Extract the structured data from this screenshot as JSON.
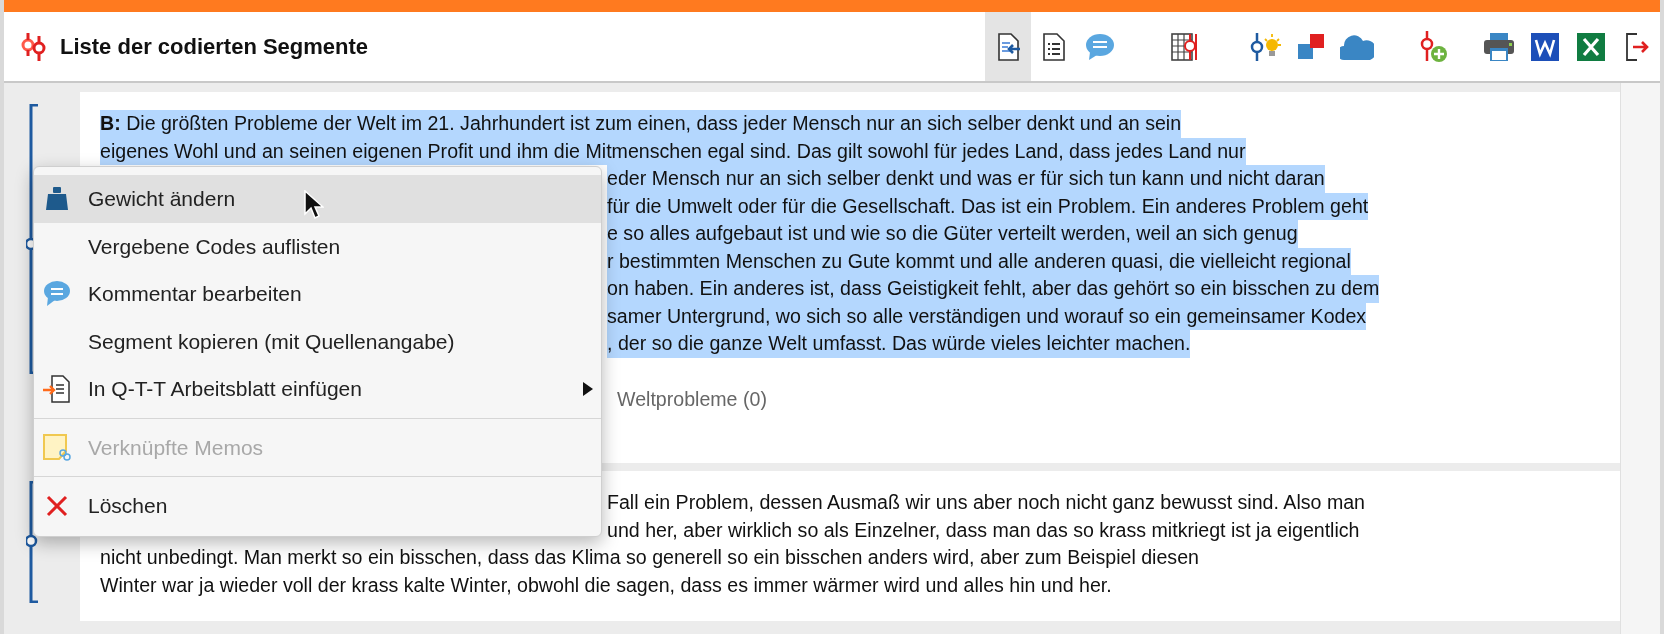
{
  "window": {
    "title": "Liste der codierten Segmente"
  },
  "toolbar": [
    {
      "selected": true
    },
    {
      "selected": false
    },
    {
      "selected": false
    },
    {
      "selected": false
    },
    {
      "selected": false
    },
    {
      "selected": false
    },
    {
      "selected": false
    },
    {
      "selected": false
    },
    {
      "selected": false
    },
    {
      "selected": false
    },
    {
      "selected": false
    },
    {
      "selected": false
    }
  ],
  "segments": [
    {
      "highlighted": true,
      "lines": [
        {
          "text": "**B:** Die größten Probleme der Welt im 21. Jahrhundert ist zum einen, dass jeder Mensch nur an sich selber denkt und an sein",
          "covered": false
        },
        {
          "text": "eigenes Wohl und an seinen eigenen Profit und ihm die Mitmenschen egal sind. Das gilt sowohl für jedes Land, dass jedes Land nur",
          "covered": false
        },
        {
          "text": "eder Mensch nur an sich selber denkt und was er für sich tun kann und nicht daran",
          "covered": true
        },
        {
          "text": "für die Umwelt oder für die Gesellschaft. Das ist ein Problem. Ein anderes Problem geht",
          "covered": true
        },
        {
          "text": "e so alles aufgebaut ist und wie so die Güter verteilt werden, weil an sich genug",
          "covered": true
        },
        {
          "text": "r bestimmten Menschen zu Gute kommt und alle anderen quasi, die vielleicht regional",
          "covered": true
        },
        {
          "text": "on haben. Ein anderes ist, dass Geistigkeit fehlt, aber das gehört so ein bisschen zu dem",
          "covered": true
        },
        {
          "text": "samer Untergrund, wo sich so alle verständigen und worauf so ein gemeinsamer Kodex",
          "covered": true
        },
        {
          "text": ", der so die ganze Welt umfasst. Das würde vieles leichter machen.",
          "covered": true
        }
      ],
      "code": "Weltprobleme (0)"
    },
    {
      "highlighted": false,
      "lines": [
        {
          "text": "Fall ein Problem, dessen Ausmaß wir uns aber noch nicht ganz bewusst sind. Also man",
          "covered": true
        },
        {
          "text": "und her, aber wirklich so als Einzelner, dass man das so krass mitkriegt ist ja eigentlich",
          "covered": true
        },
        {
          "text": "nicht unbedingt. Man merkt so ein bisschen, dass das Klima so generell so ein bisschen anders wird, aber zum Beispiel diesen",
          "covered": false
        },
        {
          "text": "Winter war ja wieder voll der krass kalte Winter, obwohl die sagen, dass es immer wärmer wird und alles hin und her.",
          "covered": false
        }
      ]
    }
  ],
  "context_menu": {
    "groups": [
      [
        {
          "label": "Gewicht ändern",
          "selected": true,
          "disabled": false,
          "submenu": false
        },
        {
          "label": "Vergebene Codes auflisten",
          "selected": false,
          "disabled": false,
          "submenu": false
        },
        {
          "label": "Kommentar bearbeiten",
          "selected": false,
          "disabled": false,
          "submenu": false
        },
        {
          "label": "Segment kopieren (mit Quellenangabe)",
          "selected": false,
          "disabled": false,
          "submenu": false
        },
        {
          "label": "In Q-T-T Arbeitsblatt einfügen",
          "selected": false,
          "disabled": false,
          "submenu": true
        }
      ],
      [
        {
          "label": "Verknüpfte Memos",
          "selected": false,
          "disabled": true,
          "submenu": false
        }
      ],
      [
        {
          "label": "Löschen",
          "selected": false,
          "disabled": false,
          "submenu": false
        }
      ]
    ]
  }
}
